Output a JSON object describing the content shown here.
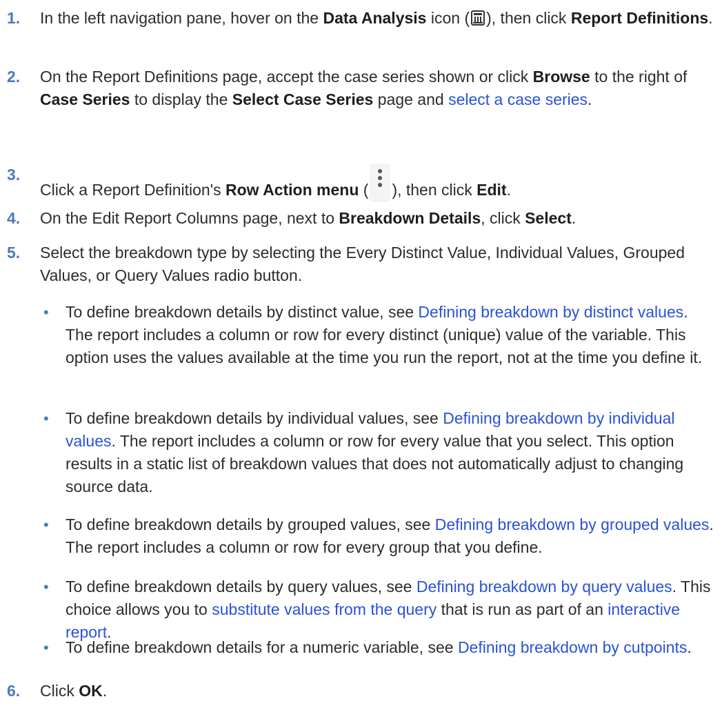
{
  "steps": [
    {
      "num": "1.",
      "t1": "In the left navigation pane, hover on the ",
      "b1": "Data Analysis",
      "t2": " icon (",
      "icon": "data-analysis-icon",
      "t3": "), then click ",
      "b2": "Report Definitions",
      "t4": "."
    },
    {
      "num": "2.",
      "t1": "On the Report Definitions page, accept the case series shown or click ",
      "b1": "Browse",
      "t2": " to the right of ",
      "b2": "Case Series",
      "t3": " to display the ",
      "b3": "Select Case Series",
      "t4": " page and ",
      "link1": "select a case series",
      "t5": "."
    },
    {
      "num": "3.",
      "t1": "Click a Report Definition's ",
      "b1": "Row Action menu",
      "t2": " (",
      "icon": "kebab-menu-icon",
      "t3": "), then click ",
      "b2": "Edit",
      "t4": "."
    },
    {
      "num": "4.",
      "t1": "On the Edit Report Columns page, next to ",
      "b1": "Breakdown Details",
      "t2": ", click ",
      "b2": "Select",
      "t3": "."
    },
    {
      "num": "5.",
      "t1": "Select the breakdown type by selecting the Every Distinct Value, Individual Values, Grouped Values, or Query Values radio button."
    },
    {
      "num": "6.",
      "t1": "Click ",
      "b1": "OK",
      "t2": "."
    }
  ],
  "bullets": [
    {
      "t1": "To define breakdown details by distinct value, see ",
      "link1": "Defining breakdown by distinct values",
      "t2": ". The report includes a column or row for every distinct (unique) value of the variable. This option uses the values available at the time you run the report, not at the time you define it."
    },
    {
      "t1": "To define breakdown details by individual values, see ",
      "link1": "Defining breakdown by individual values",
      "t2": ". The report includes a column or row for every value that you select. This option results in a static list of breakdown values that does not automatically adjust to changing source data."
    },
    {
      "t1": "To define breakdown details by grouped values, see ",
      "link1": "Defining breakdown by grouped values",
      "t2": ". The report includes a column or row for every group that you define."
    },
    {
      "t1": "To define breakdown details by query values, see ",
      "link1": "Defining breakdown by query values",
      "t2": ". This choice allows you to ",
      "link2": "substitute values from the query",
      "t3": " that is run as part of an ",
      "link3": "interactive report",
      "t4": "."
    },
    {
      "t1": "To define breakdown details for a numeric variable, see ",
      "link1": "Defining breakdown by cutpoints",
      "t2": "."
    }
  ],
  "bullet_glyph": "•",
  "colors": {
    "link": "#2a52d6",
    "number": "#4a7bbd",
    "text": "#2c2c2c"
  }
}
